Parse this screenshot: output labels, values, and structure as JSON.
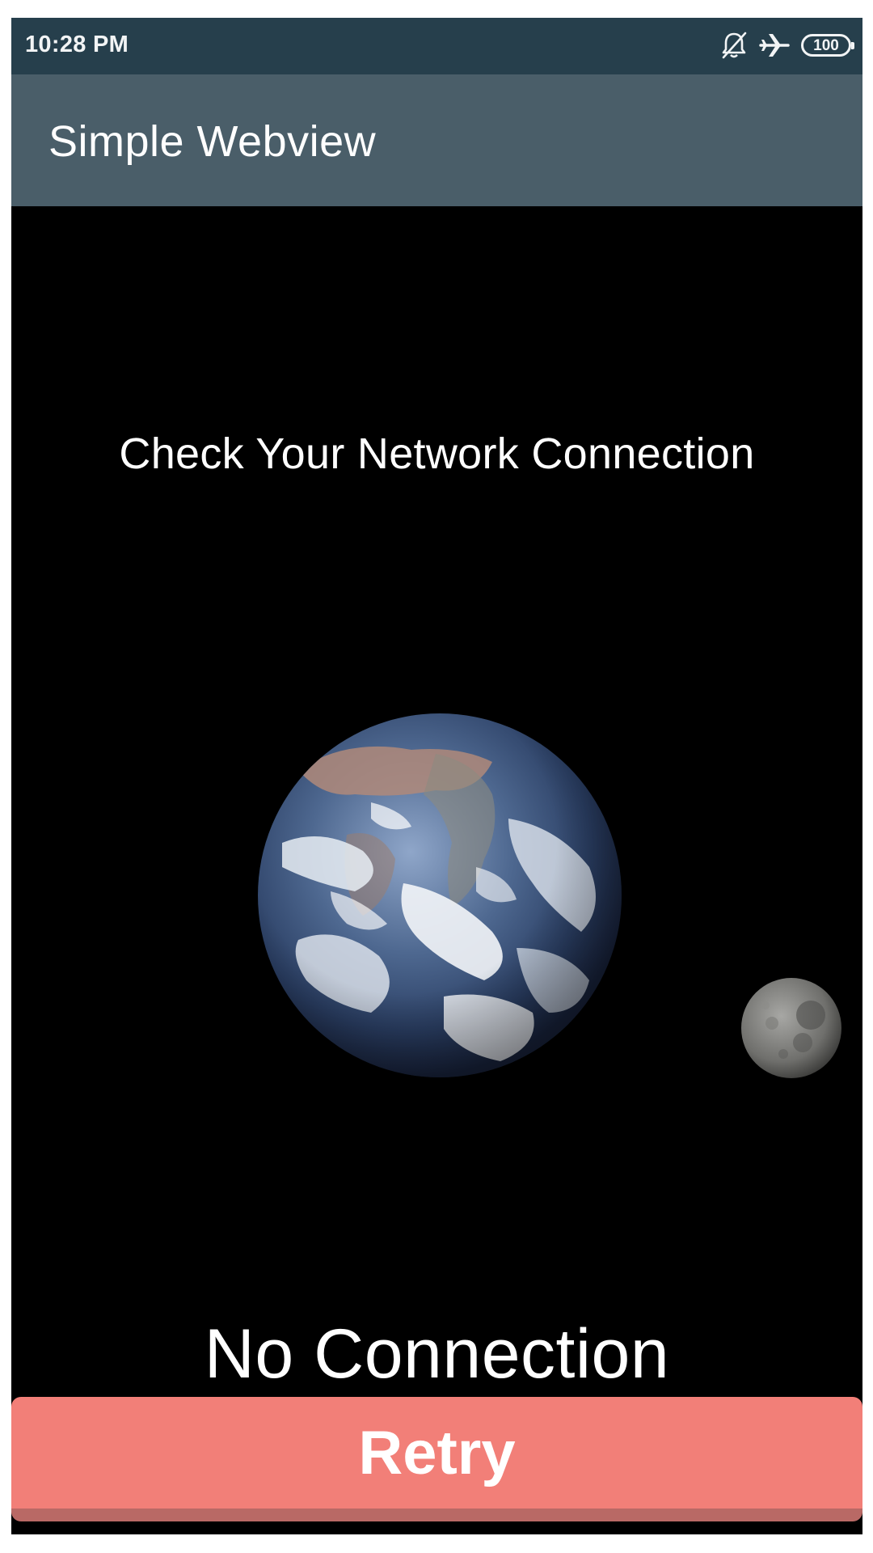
{
  "status_bar": {
    "time": "10:28 PM",
    "battery": "100",
    "icons": [
      "notifications-off-icon",
      "airplane-mode-icon",
      "battery-icon"
    ]
  },
  "app_bar": {
    "title": "Simple Webview"
  },
  "main": {
    "headline": "Check Your Network Connection",
    "illustration": "earth-and-moon",
    "status_message": "No Connection",
    "retry_label": "Retry"
  },
  "colors": {
    "status_bar": "#263f4c",
    "app_bar": "#4a5e69",
    "background": "#000000",
    "retry_button": "#f27f78"
  }
}
